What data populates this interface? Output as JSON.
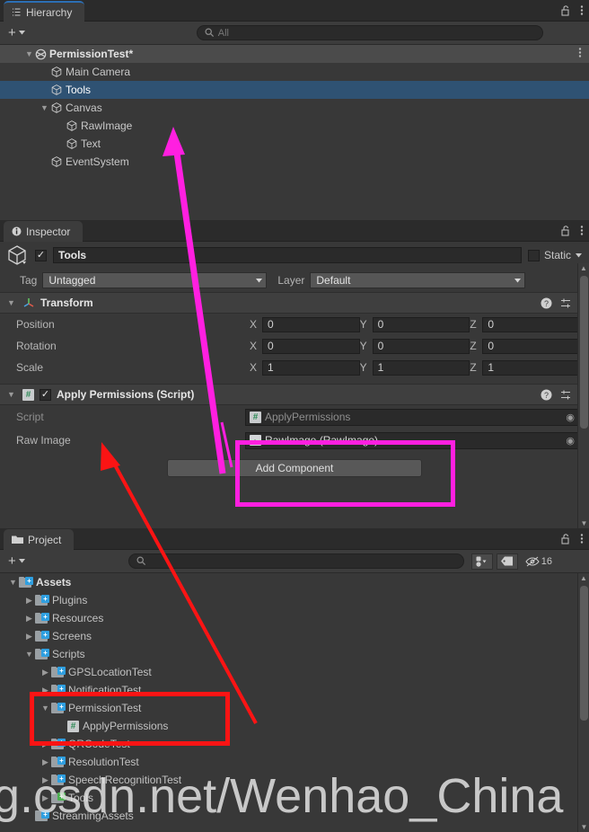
{
  "hierarchy": {
    "tab_label": "Hierarchy",
    "lock_icon": "lock-open-icon",
    "menu_icon": "kebab-menu-icon",
    "create_label": "+",
    "search": {
      "placeholder": "All",
      "value": "",
      "icon": "search-icon"
    },
    "rows": [
      {
        "label": "PermissionTest*",
        "icon": "scene-icon",
        "indent": 0,
        "twisty": "down",
        "type": "scene",
        "selected": false
      },
      {
        "label": "Main Camera",
        "icon": "gameobject-cube-icon",
        "indent": 1,
        "twisty": "",
        "type": "object",
        "selected": false
      },
      {
        "label": "Tools",
        "icon": "gameobject-cube-icon",
        "indent": 1,
        "twisty": "",
        "type": "object",
        "selected": true
      },
      {
        "label": "Canvas",
        "icon": "gameobject-cube-icon",
        "indent": 1,
        "twisty": "down",
        "type": "object",
        "selected": false
      },
      {
        "label": "RawImage",
        "icon": "gameobject-cube-icon",
        "indent": 2,
        "twisty": "",
        "type": "object",
        "selected": false
      },
      {
        "label": "Text",
        "icon": "gameobject-cube-icon",
        "indent": 2,
        "twisty": "",
        "type": "object",
        "selected": false
      },
      {
        "label": "EventSystem",
        "icon": "gameobject-cube-icon",
        "indent": 1,
        "twisty": "",
        "type": "object",
        "selected": false
      }
    ]
  },
  "inspector": {
    "tab_label": "Inspector",
    "tab_icon": "info-icon",
    "lock_icon": "lock-open-icon",
    "menu_icon": "kebab-menu-icon",
    "object": {
      "enabled": true,
      "name": "Tools",
      "static_label": "Static",
      "static_checked": false,
      "tag_label": "Tag",
      "tag_value": "Untagged",
      "layer_label": "Layer",
      "layer_value": "Default"
    },
    "transform": {
      "title": "Transform",
      "icon": "transform-axis-icon",
      "help_icon": "help-icon",
      "preset_icon": "preset-icon",
      "menu_icon": "kebab-menu-icon",
      "rows": [
        {
          "label": "Position",
          "x": "0",
          "y": "0",
          "z": "0"
        },
        {
          "label": "Rotation",
          "x": "0",
          "y": "0",
          "z": "0"
        },
        {
          "label": "Scale",
          "x": "1",
          "y": "1",
          "z": "1"
        }
      ],
      "axis_labels": [
        "X",
        "Y",
        "Z"
      ]
    },
    "script_component": {
      "title": "Apply Permissions (Script)",
      "icon": "csharp-script-icon",
      "enabled": true,
      "help_icon": "help-icon",
      "preset_icon": "preset-icon",
      "menu_icon": "kebab-menu-icon",
      "fields": [
        {
          "label": "Script",
          "value": "ApplyPermissions",
          "icon": "csharp-script-icon",
          "picker": "object-picker-icon",
          "dimmed": true
        },
        {
          "label": "Raw Image",
          "value": "RawImage (RawImage)",
          "icon": "rawimage-icon",
          "picker": "object-picker-icon",
          "dimmed": false
        }
      ]
    },
    "add_component_label": "Add Component"
  },
  "project": {
    "tab_label": "Project",
    "tab_icon": "folder-icon",
    "lock_icon": "lock-open-icon",
    "menu_icon": "kebab-menu-icon",
    "create_label": "+",
    "search": {
      "placeholder": "",
      "value": "",
      "icon": "search-icon"
    },
    "filter_buttons": [
      {
        "name": "asset-type-filter",
        "icon": "asset-filter-icon"
      },
      {
        "name": "label-filter",
        "icon": "tag-icon"
      }
    ],
    "hidden_count": "16",
    "hidden_icon": "eye-crossed-icon",
    "tree": [
      {
        "label": "Assets",
        "indent": 0,
        "twisty": "down",
        "icon": "folder-blue-icon",
        "bold": true
      },
      {
        "label": "Plugins",
        "indent": 1,
        "twisty": "right",
        "icon": "folder-blue-icon",
        "bold": false
      },
      {
        "label": "Resources",
        "indent": 1,
        "twisty": "right",
        "icon": "folder-blue-icon",
        "bold": false
      },
      {
        "label": "Screens",
        "indent": 1,
        "twisty": "right",
        "icon": "folder-blue-icon",
        "bold": false
      },
      {
        "label": "Scripts",
        "indent": 1,
        "twisty": "down",
        "icon": "folder-blue-icon",
        "bold": false
      },
      {
        "label": "GPSLocationTest",
        "indent": 2,
        "twisty": "right",
        "icon": "folder-blue-icon",
        "bold": false
      },
      {
        "label": "NotificationTest",
        "indent": 2,
        "twisty": "right",
        "icon": "folder-blue-icon",
        "bold": false
      },
      {
        "label": "PermissionTest",
        "indent": 2,
        "twisty": "down",
        "icon": "folder-blue-icon",
        "bold": false
      },
      {
        "label": "ApplyPermissions",
        "indent": 3,
        "twisty": "",
        "icon": "csharp-script-icon",
        "bold": false
      },
      {
        "label": "QRCodeTest",
        "indent": 2,
        "twisty": "right",
        "icon": "folder-blue-icon",
        "bold": false
      },
      {
        "label": "ResolutionTest",
        "indent": 2,
        "twisty": "right",
        "icon": "folder-blue-icon",
        "bold": false
      },
      {
        "label": "SpeechRecognitionTest",
        "indent": 2,
        "twisty": "right",
        "icon": "folder-blue-icon",
        "bold": false
      },
      {
        "label": "Tools",
        "indent": 2,
        "twisty": "right",
        "icon": "folder-green-icon",
        "bold": false
      },
      {
        "label": "StreamingAssets",
        "indent": 1,
        "twisty": "",
        "icon": "folder-blue-icon",
        "bold": false
      }
    ]
  },
  "annotations": {
    "magenta_color": "#ff1fe0",
    "red_color": "#fb1414",
    "magenta_box": {
      "target": "script-fields-group"
    },
    "magenta_arrow": {
      "from": "script-fields-group",
      "to": "hierarchy-row-rawimage"
    },
    "red_box": {
      "target": "project-permissiontest-group"
    },
    "red_arrow": {
      "from": "project-applypermissions-item",
      "to": "script-component-header"
    }
  },
  "watermark": {
    "text": "g.csdn.net/Wenhao_China"
  }
}
